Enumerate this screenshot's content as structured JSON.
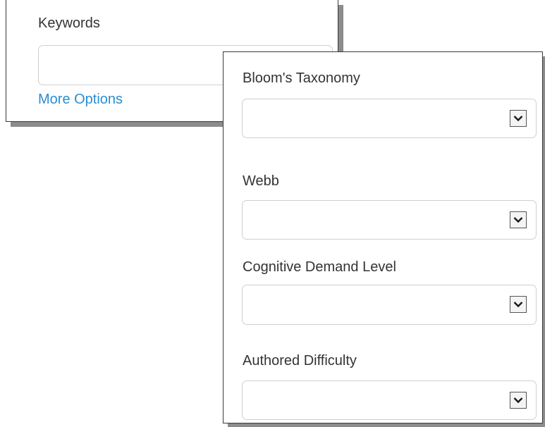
{
  "search": {
    "keywords_label": "Keywords",
    "keywords_value": "",
    "more_options_link": "More Options"
  },
  "more_options": {
    "filters": [
      {
        "label": "Bloom's Taxonomy",
        "value": ""
      },
      {
        "label": "Webb",
        "value": ""
      },
      {
        "label": "Cognitive Demand Level",
        "value": ""
      },
      {
        "label": "Authored Difficulty",
        "value": ""
      }
    ]
  },
  "icons": {
    "dropdown": "chevron-down-icon"
  },
  "colors": {
    "link": "#2a8dd4",
    "text": "#333333",
    "border": "#cfcfcf"
  }
}
